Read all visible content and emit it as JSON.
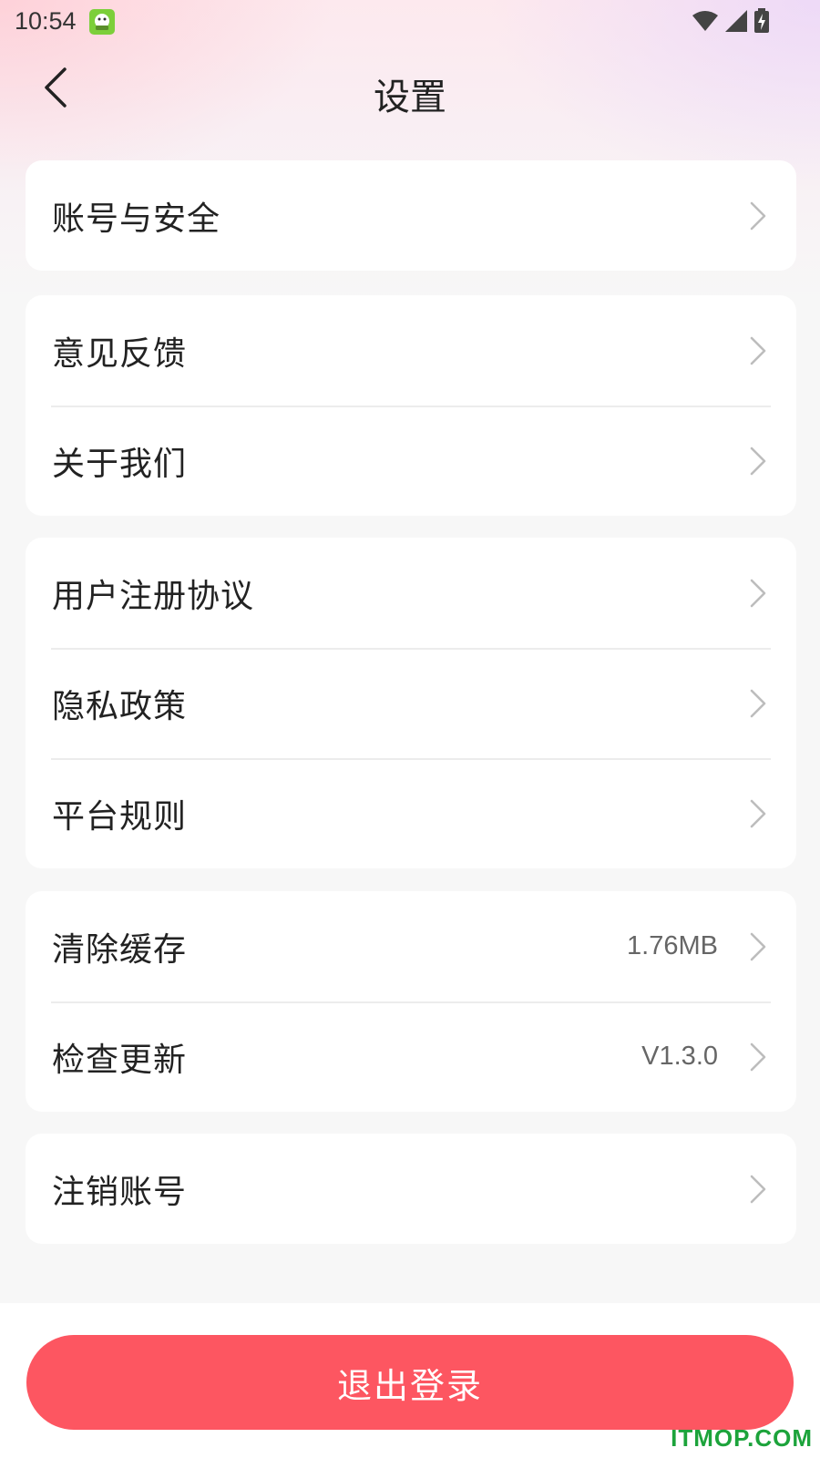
{
  "status_bar": {
    "time": "10:54",
    "icons": [
      "app-notification-icon",
      "wifi-icon",
      "cellular-signal-icon",
      "battery-charging-icon"
    ]
  },
  "header": {
    "title": "设置",
    "back_icon": "chevron-left-icon"
  },
  "groups": [
    {
      "items": [
        {
          "label": "账号与安全"
        }
      ]
    },
    {
      "items": [
        {
          "label": "意见反馈"
        },
        {
          "label": "关于我们"
        }
      ]
    },
    {
      "items": [
        {
          "label": "用户注册协议"
        },
        {
          "label": "隐私政策"
        },
        {
          "label": "平台规则"
        }
      ]
    },
    {
      "items": [
        {
          "label": "清除缓存",
          "value": "1.76MB"
        },
        {
          "label": "检查更新",
          "value": "V1.3.0"
        }
      ]
    },
    {
      "items": [
        {
          "label": "注销账号"
        }
      ]
    }
  ],
  "logout_label": "退出登录",
  "watermark": "ITMOP.COM",
  "colors": {
    "accent": "#fd5661",
    "background": "#f7f7f7",
    "card": "#ffffff",
    "chevron": "#bdbdbd",
    "watermark": "#1ca33b"
  }
}
